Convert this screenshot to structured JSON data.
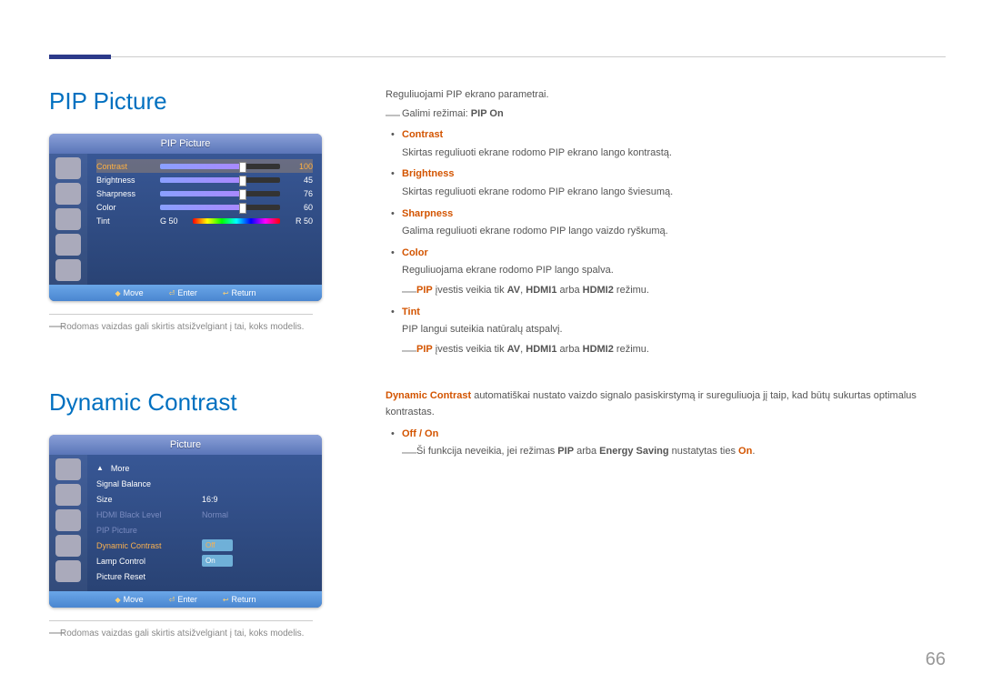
{
  "page_number": "66",
  "footnote": "Rodomas vaizdas gali skirtis atsižvelgiant į tai, koks modelis.",
  "section1": {
    "heading": "PIP Picture",
    "intro": "Reguliuojami PIP ekrano parametrai.",
    "modes_prefix": "Galimi režimai: ",
    "modes_value": "PIP On",
    "items": [
      {
        "term": "Contrast",
        "desc": "Skirtas reguliuoti ekrane rodomo PIP ekrano lango kontrastą."
      },
      {
        "term": "Brightness",
        "desc": "Skirtas reguliuoti ekrane rodomo PIP ekrano lango šviesumą."
      },
      {
        "term": "Sharpness",
        "desc": "Galima reguliuoti ekrane rodomo PIP lango vaizdo ryškumą."
      }
    ],
    "color": {
      "term": "Color",
      "desc": "Reguliuojama ekrane rodomo PIP lango spalva.",
      "note_pip": "PIP",
      "note_mid": " įvestis veikia tik ",
      "note_av": "AV",
      "note_sep1": ", ",
      "note_h1": "HDMI1",
      "note_sep2": " arba ",
      "note_h2": "HDMI2",
      "note_end": " režimu."
    },
    "tint": {
      "term": "Tint",
      "desc": "PIP langui suteikia natūralų atspalvį."
    },
    "osd": {
      "title": "PIP Picture",
      "rows": [
        {
          "label": "Contrast",
          "value": "100",
          "sel": true
        },
        {
          "label": "Brightness",
          "value": "45"
        },
        {
          "label": "Sharpness",
          "value": "76"
        },
        {
          "label": "Color",
          "value": "60"
        }
      ],
      "tint": {
        "label": "Tint",
        "left": "G  50",
        "right": "R  50"
      },
      "footer": {
        "move": "Move",
        "enter": "Enter",
        "return": "Return"
      }
    }
  },
  "section2": {
    "heading": "Dynamic Contrast",
    "intro_dc": "Dynamic Contrast",
    "intro_text": " automatiškai nustato vaizdo signalo pasiskirstymą ir sureguliuoja jį taip, kad būtų sukurtas optimalus kontrastas.",
    "offon": "Off / On",
    "note_prefix": "Ši funkcija neveikia, jei režimas ",
    "note_pip": "PIP",
    "note_mid": " arba ",
    "note_es": "Energy Saving",
    "note_suffix": " nustatytas ties ",
    "note_on": "On",
    "note_period": ".",
    "osd": {
      "title": "Picture",
      "more": "More",
      "rows": [
        {
          "label": "Signal Balance",
          "value": ""
        },
        {
          "label": "Size",
          "value": "16:9"
        },
        {
          "label": "HDMI Black Level",
          "value": "Normal",
          "dim": true
        },
        {
          "label": "PIP Picture",
          "value": "",
          "dim": true
        },
        {
          "label": "Dynamic Contrast",
          "value": "Off",
          "chip": true,
          "orange": true
        },
        {
          "label": "Lamp Control",
          "value": "On",
          "chip": true
        },
        {
          "label": "Picture Reset",
          "value": ""
        }
      ],
      "footer": {
        "move": "Move",
        "enter": "Enter",
        "return": "Return"
      }
    }
  }
}
